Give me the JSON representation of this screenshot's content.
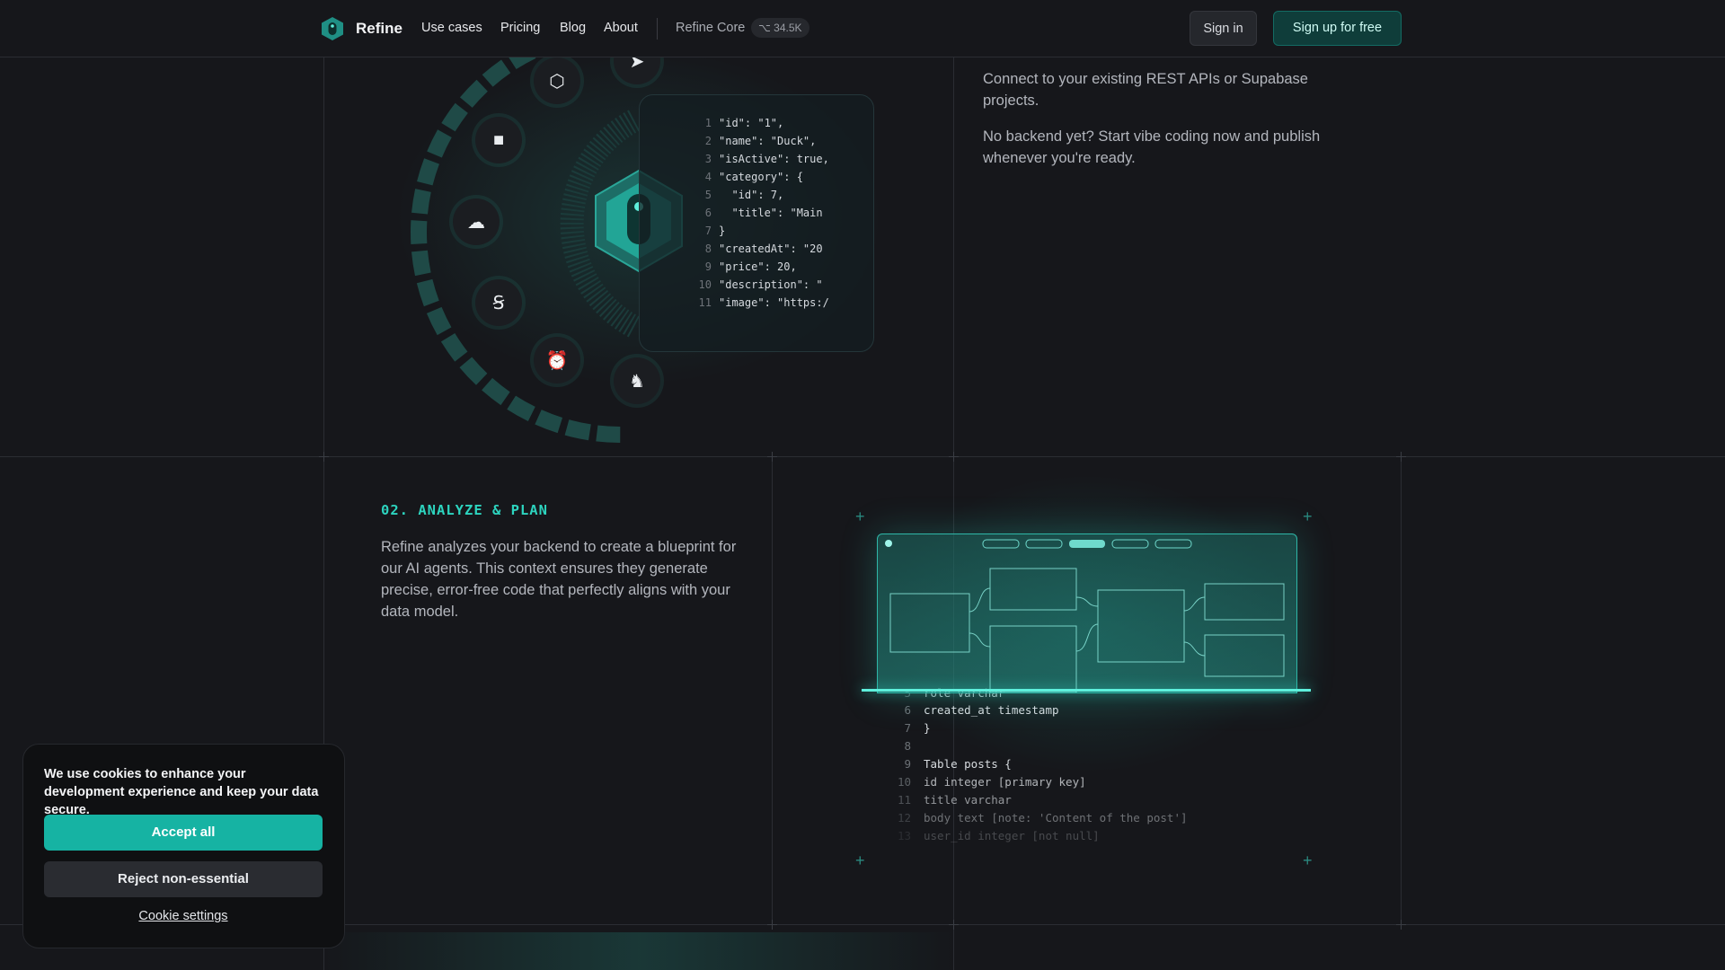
{
  "header": {
    "brand": "Refine",
    "nav": [
      "Use cases",
      "Pricing",
      "Blog",
      "About"
    ],
    "core_label": "Refine Core",
    "stars": "34.5K",
    "signin_label": "Sign in",
    "signup_label": "Sign up for free",
    "accent_color": "#2dd4bf"
  },
  "section_connect": {
    "paragraph_1": "Connect to your existing REST APIs or Supabase projects.",
    "paragraph_2": "No backend yet? Start vibe coding now and publish whenever you're ready.",
    "integration_icons": [
      "graphql-icon",
      "strapi-icon",
      "square-icon",
      "cloud-icon",
      "appwrite-icon",
      "alarm-icon",
      "nestjs-icon"
    ],
    "code_lines": [
      {
        "num": "1",
        "text": "\"id\": \"1\","
      },
      {
        "num": "2",
        "text": "\"name\": \"Duck\","
      },
      {
        "num": "3",
        "text": "\"isActive\": true,"
      },
      {
        "num": "4",
        "text": "\"category\": {"
      },
      {
        "num": "5",
        "text": "  \"id\": 7,"
      },
      {
        "num": "6",
        "text": "  \"title\": \"Main"
      },
      {
        "num": "7",
        "text": "}"
      },
      {
        "num": "8",
        "text": "\"createdAt\": \"20"
      },
      {
        "num": "9",
        "text": "\"price\": 20,"
      },
      {
        "num": "10",
        "text": "\"description\": \""
      },
      {
        "num": "11",
        "text": "\"image\": \"https:/"
      }
    ]
  },
  "section_analyze": {
    "title": "02. ANALYZE & PLAN",
    "description": "Refine analyzes your backend to create a blueprint for our AI agents. This context ensures they generate precise, error-free code that perfectly aligns with your data model.",
    "sql_lines": [
      {
        "num": "5",
        "text": "role varchar"
      },
      {
        "num": "6",
        "text": "created_at timestamp"
      },
      {
        "num": "7",
        "text": "}"
      },
      {
        "num": "8",
        "text": ""
      },
      {
        "num": "9",
        "text": "Table posts {"
      },
      {
        "num": "10",
        "text": "id integer [primary key]"
      },
      {
        "num": "11",
        "text": "title varchar"
      },
      {
        "num": "12",
        "text": "body text [note: 'Content of the post']"
      },
      {
        "num": "13",
        "text": "user_id integer [not null]"
      }
    ]
  },
  "cookie": {
    "message": "We use cookies to enhance your development experience and keep your data secure.",
    "accept_label": "Accept all",
    "reject_label": "Reject non-essential",
    "settings_label": "Cookie settings"
  }
}
